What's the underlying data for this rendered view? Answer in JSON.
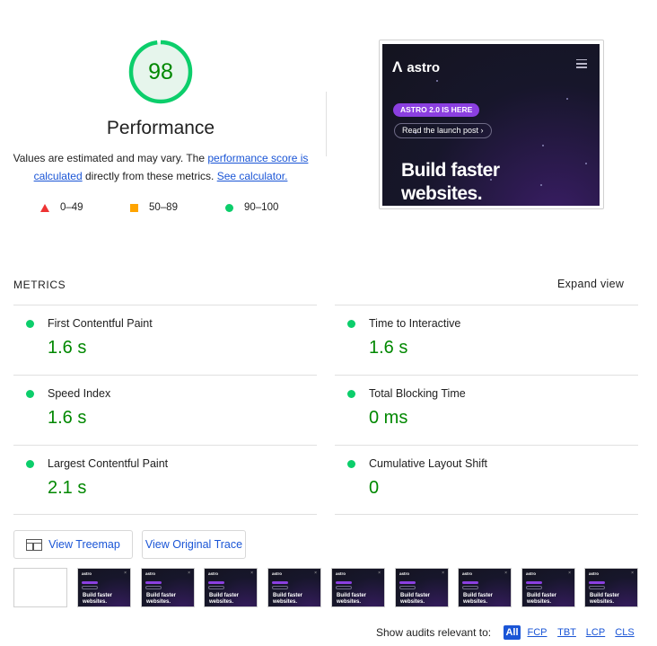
{
  "summary": {
    "score": "98",
    "score_fraction": 0.98,
    "category": "Performance",
    "desc_prefix": "Values are estimated and may vary. The ",
    "desc_link_score": "performance score is calculated",
    "desc_middle": " directly from these metrics. ",
    "desc_link_calculator": "See calculator.",
    "legend": [
      {
        "range": "0–49",
        "shape": "triangle",
        "color": "#ee3333"
      },
      {
        "range": "50–89",
        "shape": "square",
        "color": "#ffa400"
      },
      {
        "range": "90–100",
        "shape": "circle",
        "color": "#0cce6b"
      }
    ],
    "colors": {
      "pass": "#0cce6b",
      "pass_text": "#008800",
      "gauge_track": "#e6f5ec",
      "link": "#1a55d6"
    }
  },
  "final_screenshot": {
    "logo": "astro",
    "logo_mark_icon": "astro-logo-icon",
    "menu_icon": "hamburger-icon",
    "pill": "ASTRO 2.0 IS HERE",
    "link": "Read the launch post ›",
    "headline_line1": "Build faster",
    "headline_line2": "websites."
  },
  "metrics": {
    "header": "METRICS",
    "expand": "Expand view",
    "items": [
      {
        "label": "First Contentful Paint",
        "value": "1.6 s"
      },
      {
        "label": "Time to Interactive",
        "value": "1.6 s"
      },
      {
        "label": "Speed Index",
        "value": "1.6 s"
      },
      {
        "label": "Total Blocking Time",
        "value": "0 ms"
      },
      {
        "label": "Largest Contentful Paint",
        "value": "2.1 s"
      },
      {
        "label": "Cumulative Layout Shift",
        "value": "0"
      }
    ]
  },
  "buttons": {
    "treemap": "View Treemap",
    "treemap_icon": "treemap-icon",
    "trace": "View Original Trace"
  },
  "filmstrip": {
    "frames": [
      {
        "blank": true
      },
      {
        "logo": "astro",
        "headline1": "Build faster",
        "headline2": "websites."
      },
      {
        "logo": "astro",
        "headline1": "Build faster",
        "headline2": "websites."
      },
      {
        "logo": "astro",
        "headline1": "Build faster",
        "headline2": "websites."
      },
      {
        "logo": "astro",
        "headline1": "Build faster",
        "headline2": "websites."
      },
      {
        "logo": "astro",
        "headline1": "Build faster",
        "headline2": "websites."
      },
      {
        "logo": "astro",
        "headline1": "Build faster",
        "headline2": "websites."
      },
      {
        "logo": "astro",
        "headline1": "Build faster",
        "headline2": "websites."
      },
      {
        "logo": "astro",
        "headline1": "Build faster",
        "headline2": "websites."
      },
      {
        "logo": "astro",
        "headline1": "Build faster",
        "headline2": "websites."
      }
    ]
  },
  "audit_filter": {
    "label": "Show audits relevant to:",
    "chips": [
      "All",
      "FCP",
      "TBT",
      "LCP",
      "CLS"
    ],
    "active": "All"
  }
}
